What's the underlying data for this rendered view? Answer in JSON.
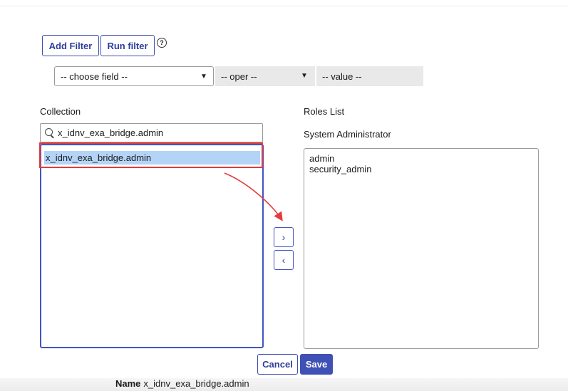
{
  "filter": {
    "add_label": "Add Filter",
    "run_label": "Run filter",
    "help_symbol": "?",
    "field_value": "-- choose field --",
    "oper_value": "-- oper --",
    "value_value": "-- value --",
    "caret": "▼"
  },
  "collection": {
    "label": "Collection",
    "search_value": "x_idnv_exa_bridge.admin",
    "items": [
      "x_idnv_exa_bridge.admin"
    ]
  },
  "roles": {
    "label": "Roles List",
    "sublabel": "System Administrator",
    "items": [
      "admin",
      "security_admin"
    ]
  },
  "move": {
    "right": "›",
    "left": "‹"
  },
  "actions": {
    "cancel": "Cancel",
    "save": "Save"
  },
  "footer": {
    "name_label": "Name",
    "name_value": "x_idnv_exa_bridge.admin"
  },
  "colors": {
    "accent": "#3f51b5",
    "annotation": "#e43b3b",
    "selection": "#b4d4f7"
  }
}
